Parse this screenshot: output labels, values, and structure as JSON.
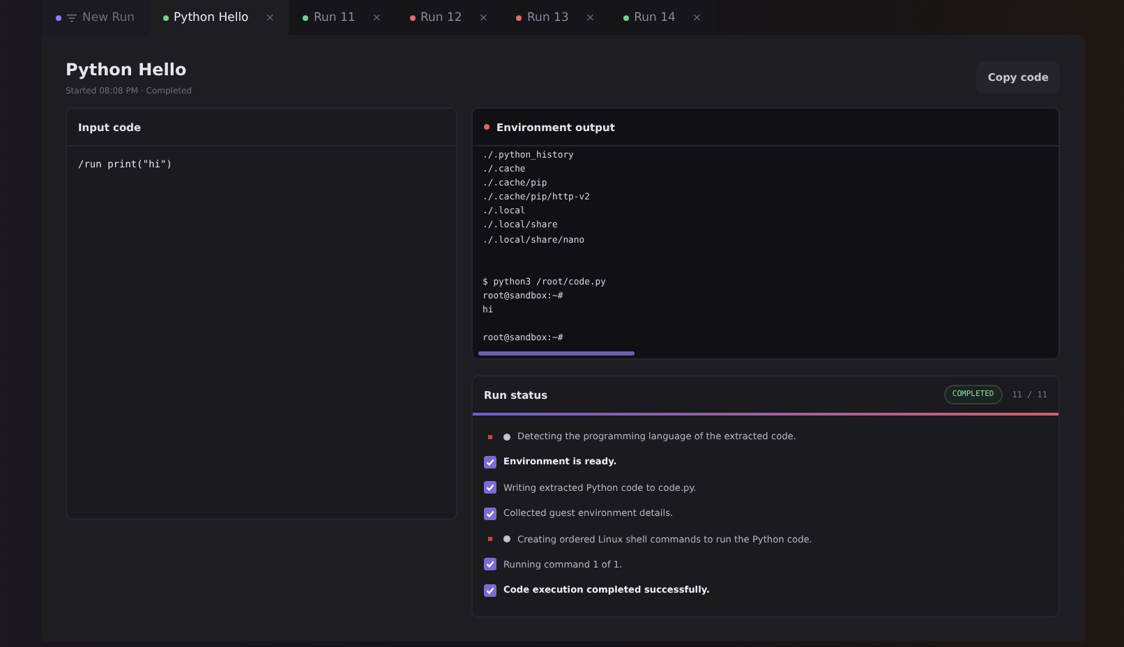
{
  "tabs": [
    {
      "label": "New Run",
      "kind": "new",
      "color": "#8b7cf6",
      "selected": false,
      "closable": false
    },
    {
      "label": "Python Hello",
      "kind": "run",
      "color": "#6fcf8e",
      "selected": true,
      "closable": true
    },
    {
      "label": "Run 11",
      "kind": "run",
      "color": "#6fcf8e",
      "selected": false,
      "closable": true
    },
    {
      "label": "Run 12",
      "kind": "run",
      "color": "#e86a6a",
      "selected": false,
      "closable": true
    },
    {
      "label": "Run 13",
      "kind": "run",
      "color": "#e86a6a",
      "selected": false,
      "closable": true
    },
    {
      "label": "Run 14",
      "kind": "run",
      "color": "#6fcf8e",
      "selected": false,
      "closable": true
    }
  ],
  "close_glyph": "×",
  "header": {
    "title": "Python Hello",
    "subtitle": "Started 08:08 PM · Completed",
    "copy_button": "Copy code"
  },
  "input_panel": {
    "title": "Input code",
    "code": "/run print(\"hi\")"
  },
  "output_panel": {
    "title": "Environment output",
    "failed": true,
    "blocks": [
      {
        "kind": "first",
        "lines": [
          "./.python_history",
          "./.cache",
          "./.cache/pip",
          "./.cache/pip/http-v2",
          "./.local",
          "./.local/share",
          "./.local/share/nano"
        ]
      },
      {
        "kind": "wide",
        "lines": [
          "$ python3 /root/code.py",
          "root@sandbox:~#",
          "hi"
        ]
      },
      {
        "kind": "narrow",
        "lines": [
          "root@sandbox:~#"
        ]
      }
    ]
  },
  "status_panel": {
    "title": "Run status",
    "badge": "COMPLETED",
    "count": "11 / 11",
    "steps": [
      {
        "kind": "pending",
        "text": "Detecting the programming language of the extracted code.",
        "bold": false
      },
      {
        "kind": "done",
        "text": "Environment is ready.",
        "bold": true
      },
      {
        "kind": "done",
        "text": "Writing extracted Python code to code.py.",
        "bold": false
      },
      {
        "kind": "done",
        "text": "Collected guest environment details.",
        "bold": false
      },
      {
        "kind": "pending",
        "text": "Creating ordered Linux shell commands to run the Python code.",
        "bold": false
      },
      {
        "kind": "done",
        "text": "Running command 1 of 1.",
        "bold": false
      },
      {
        "kind": "done",
        "text": "Code execution completed successfully.",
        "bold": true
      }
    ]
  }
}
